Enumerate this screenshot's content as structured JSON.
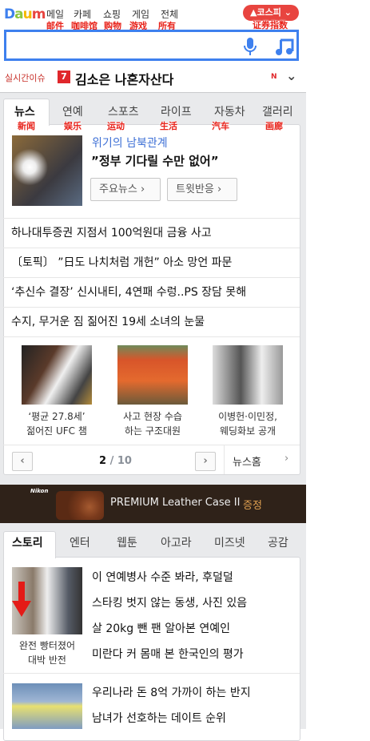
{
  "header": {
    "logo": "Daum",
    "nav": [
      {
        "label": "메일",
        "note": "邮件"
      },
      {
        "label": "카페",
        "note": "咖啡馆"
      },
      {
        "label": "쇼핑",
        "note": "购物"
      },
      {
        "label": "게임",
        "note": "游戏"
      },
      {
        "label": "전체",
        "note": "所有"
      }
    ],
    "kospi": {
      "label": "▲코스피",
      "note": "证券指数"
    },
    "search": {
      "value": "",
      "mic_icon": "mic-icon",
      "music_icon": "music-note-icon"
    }
  },
  "realtime": {
    "label": "실시간이슈",
    "rank": "7",
    "text": "김소은 나혼자산다",
    "badge": "N"
  },
  "tabs": [
    {
      "label": "뉴스",
      "note": "新闻"
    },
    {
      "label": "연예",
      "note": "娱乐"
    },
    {
      "label": "스포츠",
      "note": "运动"
    },
    {
      "label": "라이프",
      "note": "生活"
    },
    {
      "label": "자동차",
      "note": "汽车"
    },
    {
      "label": "갤러리",
      "note": "画廊"
    }
  ],
  "news": {
    "featured": {
      "category": "위기의 남북관계",
      "headline": "”정부 기다릴 수만 없어”",
      "buttons": [
        "주요뉴스 ›",
        "트윗반응 ›"
      ]
    },
    "items": [
      "하나대투증권 지점서 100억원대 금융 사고",
      "〔토픽〕 ”日도 나치처럼 개헌” 아소 망언 파문",
      "‘추신수 결장’ 신시내티, 4연패 수렁..PS 장담 못해",
      "수지, 무거운 짐 짊어진 19세 소녀의 눈물"
    ],
    "photos": [
      {
        "line1": "‘평균 27.8세’",
        "line2": "젊어진 UFC 챔"
      },
      {
        "line1": "사고 현장 수습",
        "line2": "하는 구조대원"
      },
      {
        "line1": "이병헌·이민정,",
        "line2": "웨딩화보 공개"
      }
    ],
    "pager": {
      "current": "2",
      "total": "/ 10",
      "home": "뉴스홈"
    }
  },
  "ad": {
    "brand": "Nikon",
    "text": "PREMIUM Leather Case II",
    "highlight": "증정"
  },
  "tabs2": [
    "스토리",
    "엔터",
    "웹툰",
    "아고라",
    "미즈넷",
    "공감"
  ],
  "story": {
    "caption1": "완전 빵터졌어",
    "caption2": "대박 반전",
    "items": [
      "이 연예병사 수준 봐라, 후덜덜",
      "스타킹 벗지 않는 동생, 사진 있음",
      "살 20kg 뺀 팬 알아본 연예인",
      "미란다 커 몸매 본 한국인의 평가"
    ],
    "items2": [
      "우리나라 돈 8억 가까이 하는 반지",
      "남녀가 선호하는 데이트 순위"
    ]
  }
}
